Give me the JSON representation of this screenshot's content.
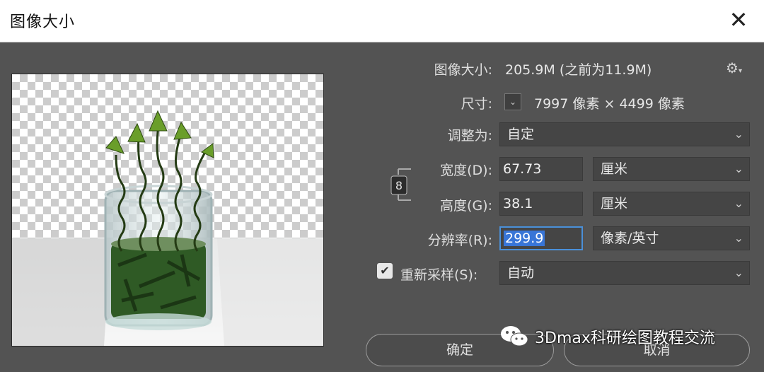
{
  "window": {
    "title": "图像大小"
  },
  "image_size": {
    "label": "图像大小:",
    "value": "205.9M (之前为11.9M)"
  },
  "dimensions": {
    "label": "尺寸:",
    "width_value": "7997",
    "unit1": "像素",
    "times": "×",
    "height_value": "4499",
    "unit2": "像素"
  },
  "fit_to": {
    "label": "调整为:",
    "value": "自定"
  },
  "width": {
    "label": "宽度(D):",
    "value": "67.73",
    "unit": "厘米"
  },
  "height": {
    "label": "高度(G):",
    "value": "38.1",
    "unit": "厘米"
  },
  "resolution": {
    "label": "分辨率(R):",
    "value": "299.9",
    "unit": "像素/英寸"
  },
  "resample": {
    "label": "重新采样(S):",
    "value": "自动",
    "checked": true
  },
  "buttons": {
    "ok": "确定",
    "cancel": "取消"
  },
  "watermark": {
    "text": "3Dmax科研绘图教程交流"
  },
  "icons": {
    "close": "close-icon",
    "gear": "gear-icon",
    "link": "chain-link-icon",
    "chevron": "chevron-down-icon",
    "check": "check-icon"
  }
}
